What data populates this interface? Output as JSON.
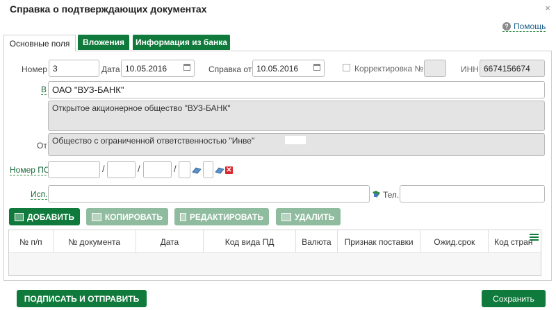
{
  "dialog": {
    "title": "Справка о подтверждающих документах",
    "close": "×"
  },
  "help": {
    "label": "Помощь",
    "icon": "question-icon"
  },
  "tabs": [
    {
      "label": "Основные поля"
    },
    {
      "label": "Вложения"
    },
    {
      "label": "Информация из банка"
    }
  ],
  "form": {
    "number_label": "Номер",
    "number_value": "3",
    "date_label": "Дата",
    "date_value": "10.05.2016",
    "ref_from_label": "Справка от",
    "ref_from_value": "10.05.2016",
    "correction_label": "Корректировка №",
    "correction_value": "",
    "inn_label": "ИНН",
    "inn_value": "6674156674",
    "to_label": "В",
    "to_value": "ОАО \"ВУЗ-БАНК\"",
    "to_full": "Открытое акционерное общество \"ВУЗ-БАНК\"",
    "from_label": "От",
    "from_value": "Общество с ограниченной ответственностью \"Инве\"",
    "ps_label": "Номер ПС",
    "ps_sep": "/",
    "exec_label": "Исп.",
    "exec_value": "",
    "tel_label": "Тел.",
    "tel_value": ""
  },
  "toolbar": {
    "add": "ДОБАВИТЬ",
    "copy": "КОПИРОВАТЬ",
    "edit": "РЕДАКТИРОВАТЬ",
    "delete": "УДАЛИТЬ"
  },
  "table": {
    "columns": [
      "№ п/п",
      "№ документа",
      "Дата",
      "Код вида ПД",
      "Валюта",
      "Признак поставки",
      "Ожид.срок",
      "Код стран"
    ]
  },
  "footer": {
    "sign_send": "ПОДПИСАТЬ И ОТПРАВИТЬ",
    "save": "Сохранить"
  },
  "colors": {
    "accent": "#0f7a3b",
    "disabled": "#8fbc9e",
    "delete_icon": "#d9272e"
  }
}
